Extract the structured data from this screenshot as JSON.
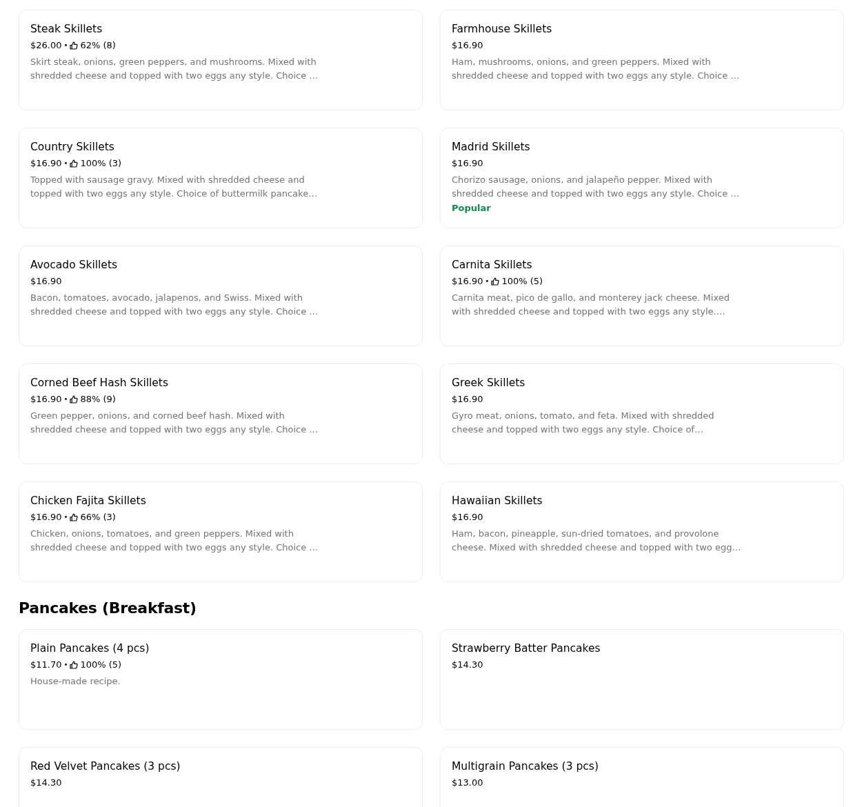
{
  "sections": [
    {
      "items": [
        {
          "name": "Steak Skillets",
          "price": "$26.00",
          "separator": "•",
          "rating": "62% (8)",
          "description": "Skirt steak, onions, green peppers, and mushrooms. Mixed with shredded cheese and topped with two eggs any style. Choice …"
        },
        {
          "name": "Farmhouse Skillets",
          "price": "$16.90",
          "description": "Ham, mushrooms, onions, and green peppers. Mixed with shredded cheese and topped with two eggs any style. Choice …"
        },
        {
          "name": "Country Skillets",
          "price": "$16.90",
          "separator": "•",
          "rating": "100% (3)",
          "description": "Topped with sausage gravy. Mixed with shredded cheese and topped with two eggs any style. Choice of buttermilk pancake…"
        },
        {
          "name": "Madrid Skillets",
          "price": "$16.90",
          "description": "Chorizo sausage, onions, and jalapeño pepper. Mixed with shredded cheese and topped with two eggs any style. Choice …",
          "badge": "Popular"
        },
        {
          "name": "Avocado Skillets",
          "price": "$16.90",
          "description": "Bacon, tomatoes, avocado, jalapenos, and Swiss. Mixed with shredded cheese and topped with two eggs any style. Choice …"
        },
        {
          "name": "Carnita Skillets",
          "price": "$16.90",
          "separator": "•",
          "rating": "100% (5)",
          "description": "Carnita meat, pico de gallo, and monterey jack cheese. Mixed with shredded cheese and topped with two eggs any style.…"
        },
        {
          "name": "Corned Beef Hash Skillets",
          "price": "$16.90",
          "separator": "•",
          "rating": "88% (9)",
          "description": "Green pepper, onions, and corned beef hash. Mixed with shredded cheese and topped with two eggs any style. Choice …"
        },
        {
          "name": "Greek Skillets",
          "price": "$16.90",
          "description": "Gyro meat, onions, tomato, and feta. Mixed with shredded cheese and topped with two eggs any style. Choice of…"
        },
        {
          "name": "Chicken Fajita Skillets",
          "price": "$16.90",
          "separator": "•",
          "rating": "66% (3)",
          "description": "Chicken, onions, tomatoes, and green peppers. Mixed with shredded cheese and topped with two eggs any style. Choice …"
        },
        {
          "name": "Hawaiian Skillets",
          "price": "$16.90",
          "description": "Ham, bacon, pineapple, sun-dried tomatoes, and provolone cheese. Mixed with shredded cheese and topped with two egg…"
        }
      ]
    },
    {
      "title": "Pancakes (Breakfast)",
      "items": [
        {
          "name": "Plain Pancakes (4 pcs)",
          "price": "$11.70",
          "separator": "•",
          "rating": "100% (5)",
          "description": "House-made recipe."
        },
        {
          "name": "Strawberry Batter Pancakes",
          "price": "$14.30"
        },
        {
          "name": "Red Velvet Pancakes (3 pcs)",
          "price": "$14.30"
        },
        {
          "name": "Multigrain Pancakes (3 pcs)",
          "price": "$13.00"
        }
      ]
    }
  ]
}
